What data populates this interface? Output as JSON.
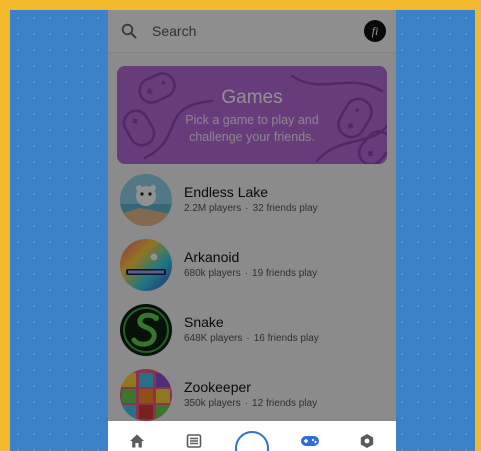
{
  "search": {
    "placeholder": "Search"
  },
  "profile": {
    "avatar_letter": "fi"
  },
  "banner": {
    "title": "Games",
    "subtitle_line1": "Pick a game to play and",
    "subtitle_line2": "challenge your friends.",
    "color": "#b36ad6"
  },
  "games": [
    {
      "name": "Endless Lake",
      "players": "2.2M players",
      "friends": "32 friends play"
    },
    {
      "name": "Arkanoid",
      "players": "680k players",
      "friends": "19 friends play"
    },
    {
      "name": "Snake",
      "players": "648K players",
      "friends": "16 friends play"
    },
    {
      "name": "Zookeeper",
      "players": "350k players",
      "friends": "12 friends play"
    }
  ],
  "meta_separator": "·",
  "nav": {
    "items": [
      {
        "icon": "home-icon"
      },
      {
        "icon": "list-icon"
      },
      {
        "icon": "ring-icon"
      },
      {
        "icon": "gamepad-icon"
      },
      {
        "icon": "hexagon-icon"
      }
    ],
    "accent": "#2f6fd6"
  },
  "colors": {
    "outer_frame": "#f1b92b",
    "backdrop": "#3b82c8"
  }
}
